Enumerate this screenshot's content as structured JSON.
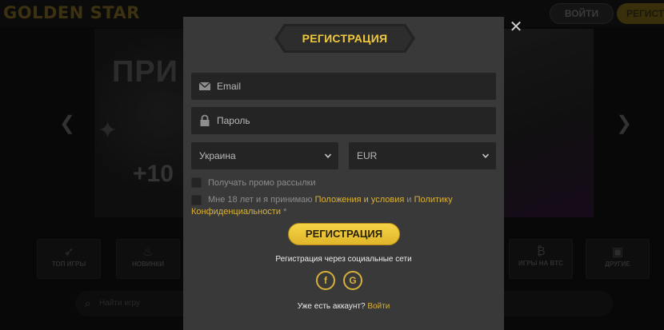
{
  "site": {
    "logo": "GOLDEN STAR",
    "login_button": "ВОЙТИ",
    "register_button": "РЕГИСТ",
    "banner_headline": "ПРИ",
    "banner_amount": "+10",
    "categories": [
      {
        "label": "ТОП ИГРЫ",
        "icon": "rocket-icon"
      },
      {
        "label": "НОВИНКИ",
        "icon": "flame-icon"
      },
      {
        "label": "ИГРЫ НА BTC",
        "icon": "bitcoin-icon"
      },
      {
        "label": "ДРУГИЕ",
        "icon": "cube-icon"
      }
    ],
    "search_placeholder": "Найти игру"
  },
  "modal": {
    "title": "РЕГИСТРАЦИЯ",
    "email_placeholder": "Email",
    "password_placeholder": "Пароль",
    "country_value": "Украина",
    "currency_value": "EUR",
    "promo_label": "Получать промо рассылки",
    "age_prefix": "Мне 18 лет и я принимаю",
    "terms_link": "Положения и условия",
    "and_word": "и",
    "privacy_link_part1": "Политику",
    "privacy_link_part2": "Конфиденциальности",
    "required_mark": "*",
    "submit_label": "РЕГИСТРАЦИЯ",
    "social_caption": "Регистрация через социальные сети",
    "facebook_glyph": "f",
    "google_glyph": "G",
    "have_account": "Уже есть аккаунт?",
    "login_link": "Войти"
  },
  "colors": {
    "accent": "#f0c93a",
    "modal_bg": "#393939",
    "field_bg": "#242424"
  }
}
